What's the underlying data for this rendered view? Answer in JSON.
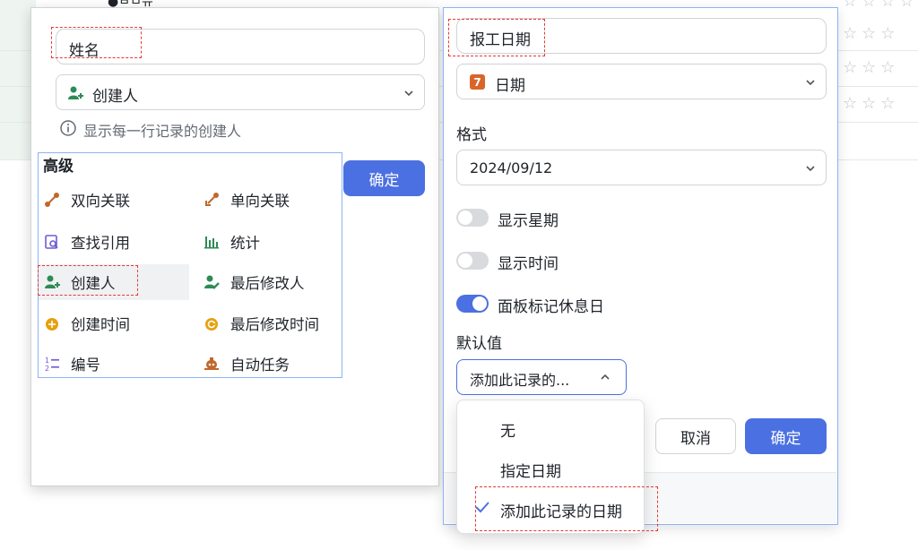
{
  "background": {
    "top_cell_text": "●ㅂㅁ뉴"
  },
  "left_dialog": {
    "name_field_value": "姓名",
    "field_type": {
      "label": "创建人",
      "icon": "user-plus-icon"
    },
    "hint": "显示每一行记录的创建人",
    "confirm_label": "确定"
  },
  "advanced": {
    "title": "高级",
    "items": [
      {
        "label": "双向关联",
        "icon": "two-way-link-icon",
        "color": "#c0682b"
      },
      {
        "label": "单向关联",
        "icon": "one-way-link-icon",
        "color": "#c0682b"
      },
      {
        "label": "查找引用",
        "icon": "lookup-icon",
        "color": "#6b5bd6"
      },
      {
        "label": "统计",
        "icon": "stats-icon",
        "color": "#2e8b57"
      },
      {
        "label": "创建人",
        "icon": "creator-icon",
        "color": "#2e8b57"
      },
      {
        "label": "最后修改人",
        "icon": "modifier-icon",
        "color": "#2e8b57"
      },
      {
        "label": "创建时间",
        "icon": "created-time-icon",
        "color": "#e6a10f"
      },
      {
        "label": "最后修改时间",
        "icon": "modified-time-icon",
        "color": "#e6a10f"
      },
      {
        "label": "编号",
        "icon": "number-icon",
        "color": "#6b5bd6"
      },
      {
        "label": "自动任务",
        "icon": "auto-task-icon",
        "color": "#c0682b"
      }
    ],
    "selected_index": 4
  },
  "right_dialog": {
    "name_field_value": "报工日期",
    "field_type": {
      "label": "日期",
      "icon": "calendar-icon",
      "icon_glyph": "7",
      "color": "#d9652b"
    },
    "format_label": "格式",
    "format_value": "2024/09/12",
    "toggles": [
      {
        "label": "显示星期",
        "on": false
      },
      {
        "label": "显示时间",
        "on": false
      },
      {
        "label": "面板标记休息日",
        "on": true
      }
    ],
    "default_label": "默认值",
    "default_value": "添加此记录的...",
    "cancel_label": "取消",
    "confirm_label": "确定"
  },
  "default_dropdown": {
    "options": [
      "无",
      "指定日期",
      "添加此记录的日期"
    ],
    "selected_index": 2
  },
  "colors": {
    "accent": "#4b70e2",
    "highlight_border": "#8cb3f5",
    "dash_red": "#e53935"
  }
}
